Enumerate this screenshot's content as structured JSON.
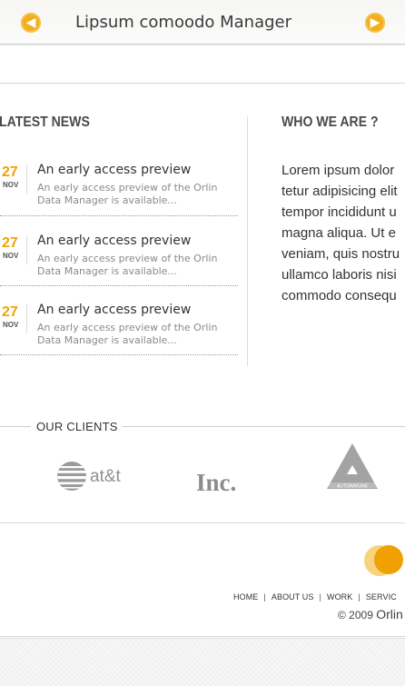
{
  "banner": {
    "title": "Lipsum comoodo Manager",
    "prev_icon": "arrow-left-icon",
    "next_icon": "arrow-right-icon",
    "accent_color": "#f2b01c"
  },
  "latest_news": {
    "heading": "LATEST NEWS",
    "items": [
      {
        "day": "27",
        "month": "NOV",
        "title": "An early access preview",
        "text": "An early access preview of the Orlin Data Manager is available..."
      },
      {
        "day": "27",
        "month": "NOV",
        "title": "An early access preview",
        "text": "An early access preview of the Orlin Data Manager is available..."
      },
      {
        "day": "27",
        "month": "NOV",
        "title": "An early access preview",
        "text": "An early access preview of the Orlin Data Manager is available..."
      }
    ]
  },
  "who_we_are": {
    "heading": "WHO WE ARE ?",
    "lines": [
      "Lorem ipsum dolor",
      "tetur adipisicing elit",
      "tempor incididunt u",
      "magna aliqua. Ut e",
      "veniam, quis nostru",
      "ullamco laboris nisi",
      "commodo consequ"
    ]
  },
  "clients": {
    "heading": "OUR CLIENTS",
    "logos": [
      {
        "name": "at&t",
        "icon": "att-globe-logo"
      },
      {
        "name": "Inc.",
        "icon": "inc-logo"
      },
      {
        "name": "AUTOIMMUNE",
        "icon": "autoimmune-triangle-logo"
      }
    ]
  },
  "footer": {
    "nav": [
      "HOME",
      "ABOUT US",
      "WORK",
      "SERVIC"
    ],
    "separator": "|",
    "copyright": "© 2009",
    "brand": "Orlin"
  }
}
